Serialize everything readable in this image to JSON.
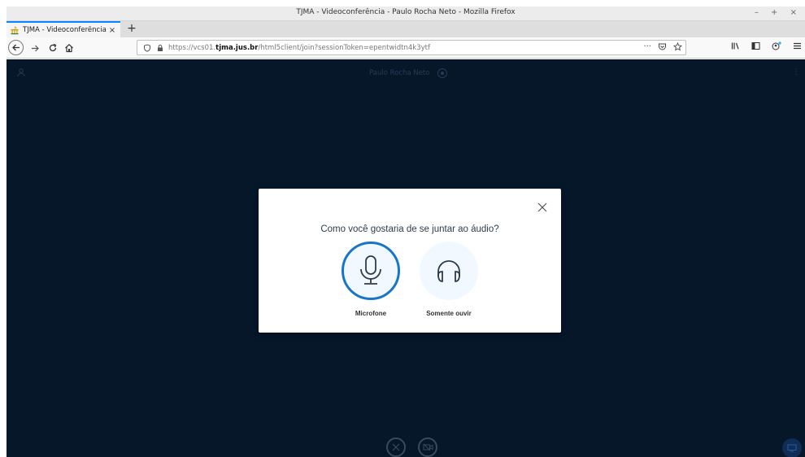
{
  "window": {
    "title": "TJMA - Videoconferência - Paulo Rocha Neto - Mozilla Firefox",
    "controls": "– + ×"
  },
  "tab": {
    "title": "TJMA - Videoconferência - P",
    "close": "×",
    "new_tab": "+"
  },
  "nav": {
    "url_prefix": "https://vcs01.",
    "url_domain": "tjma.jus.br",
    "url_path": "/html5client/join?sessionToken=epentwidtn4k3ytf",
    "url_more": "···"
  },
  "app": {
    "meeting_title": "Paulo Rocha Neto",
    "more": "⋮"
  },
  "modal": {
    "question": "Como você gostaria de se juntar ao áudio?",
    "options": [
      {
        "label": "Microfone"
      },
      {
        "label": "Somente ouvir"
      }
    ]
  },
  "colors": {
    "app_bg": "#06172a",
    "accent": "#1776c8",
    "option_bg": "#f1f8ff"
  }
}
